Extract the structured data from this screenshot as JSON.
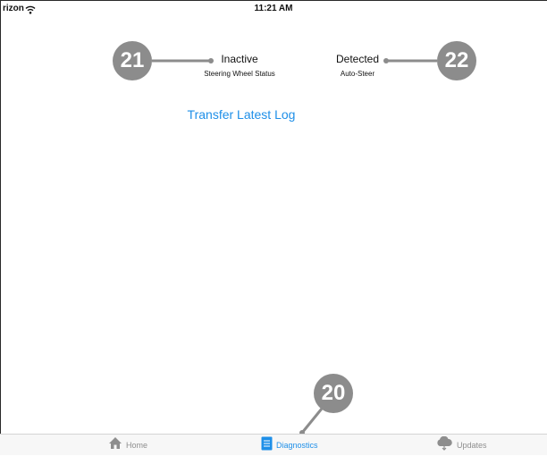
{
  "status_bar": {
    "carrier": "rizon",
    "wifi_icon": "wifi-icon",
    "time": "11:21 AM"
  },
  "status_items": [
    {
      "value": "Inactive",
      "caption": "Steering Wheel Status"
    },
    {
      "value": "Detected",
      "caption": "Auto-Steer"
    }
  ],
  "actions": {
    "transfer_label": "Transfer Latest Log"
  },
  "callouts": {
    "steering": "21",
    "autosteer": "22",
    "diagnostics": "20"
  },
  "tab_bar": {
    "tabs": [
      {
        "label": "Home",
        "icon": "home-icon",
        "active": false
      },
      {
        "label": "Diagnostics",
        "icon": "document-icon",
        "active": true
      },
      {
        "label": "Updates",
        "icon": "cloud-download-icon",
        "active": false
      }
    ]
  },
  "colors": {
    "accent": "#1e8fe8",
    "callout": "#8c8c8c",
    "tab_inactive": "#8e8e8e"
  }
}
